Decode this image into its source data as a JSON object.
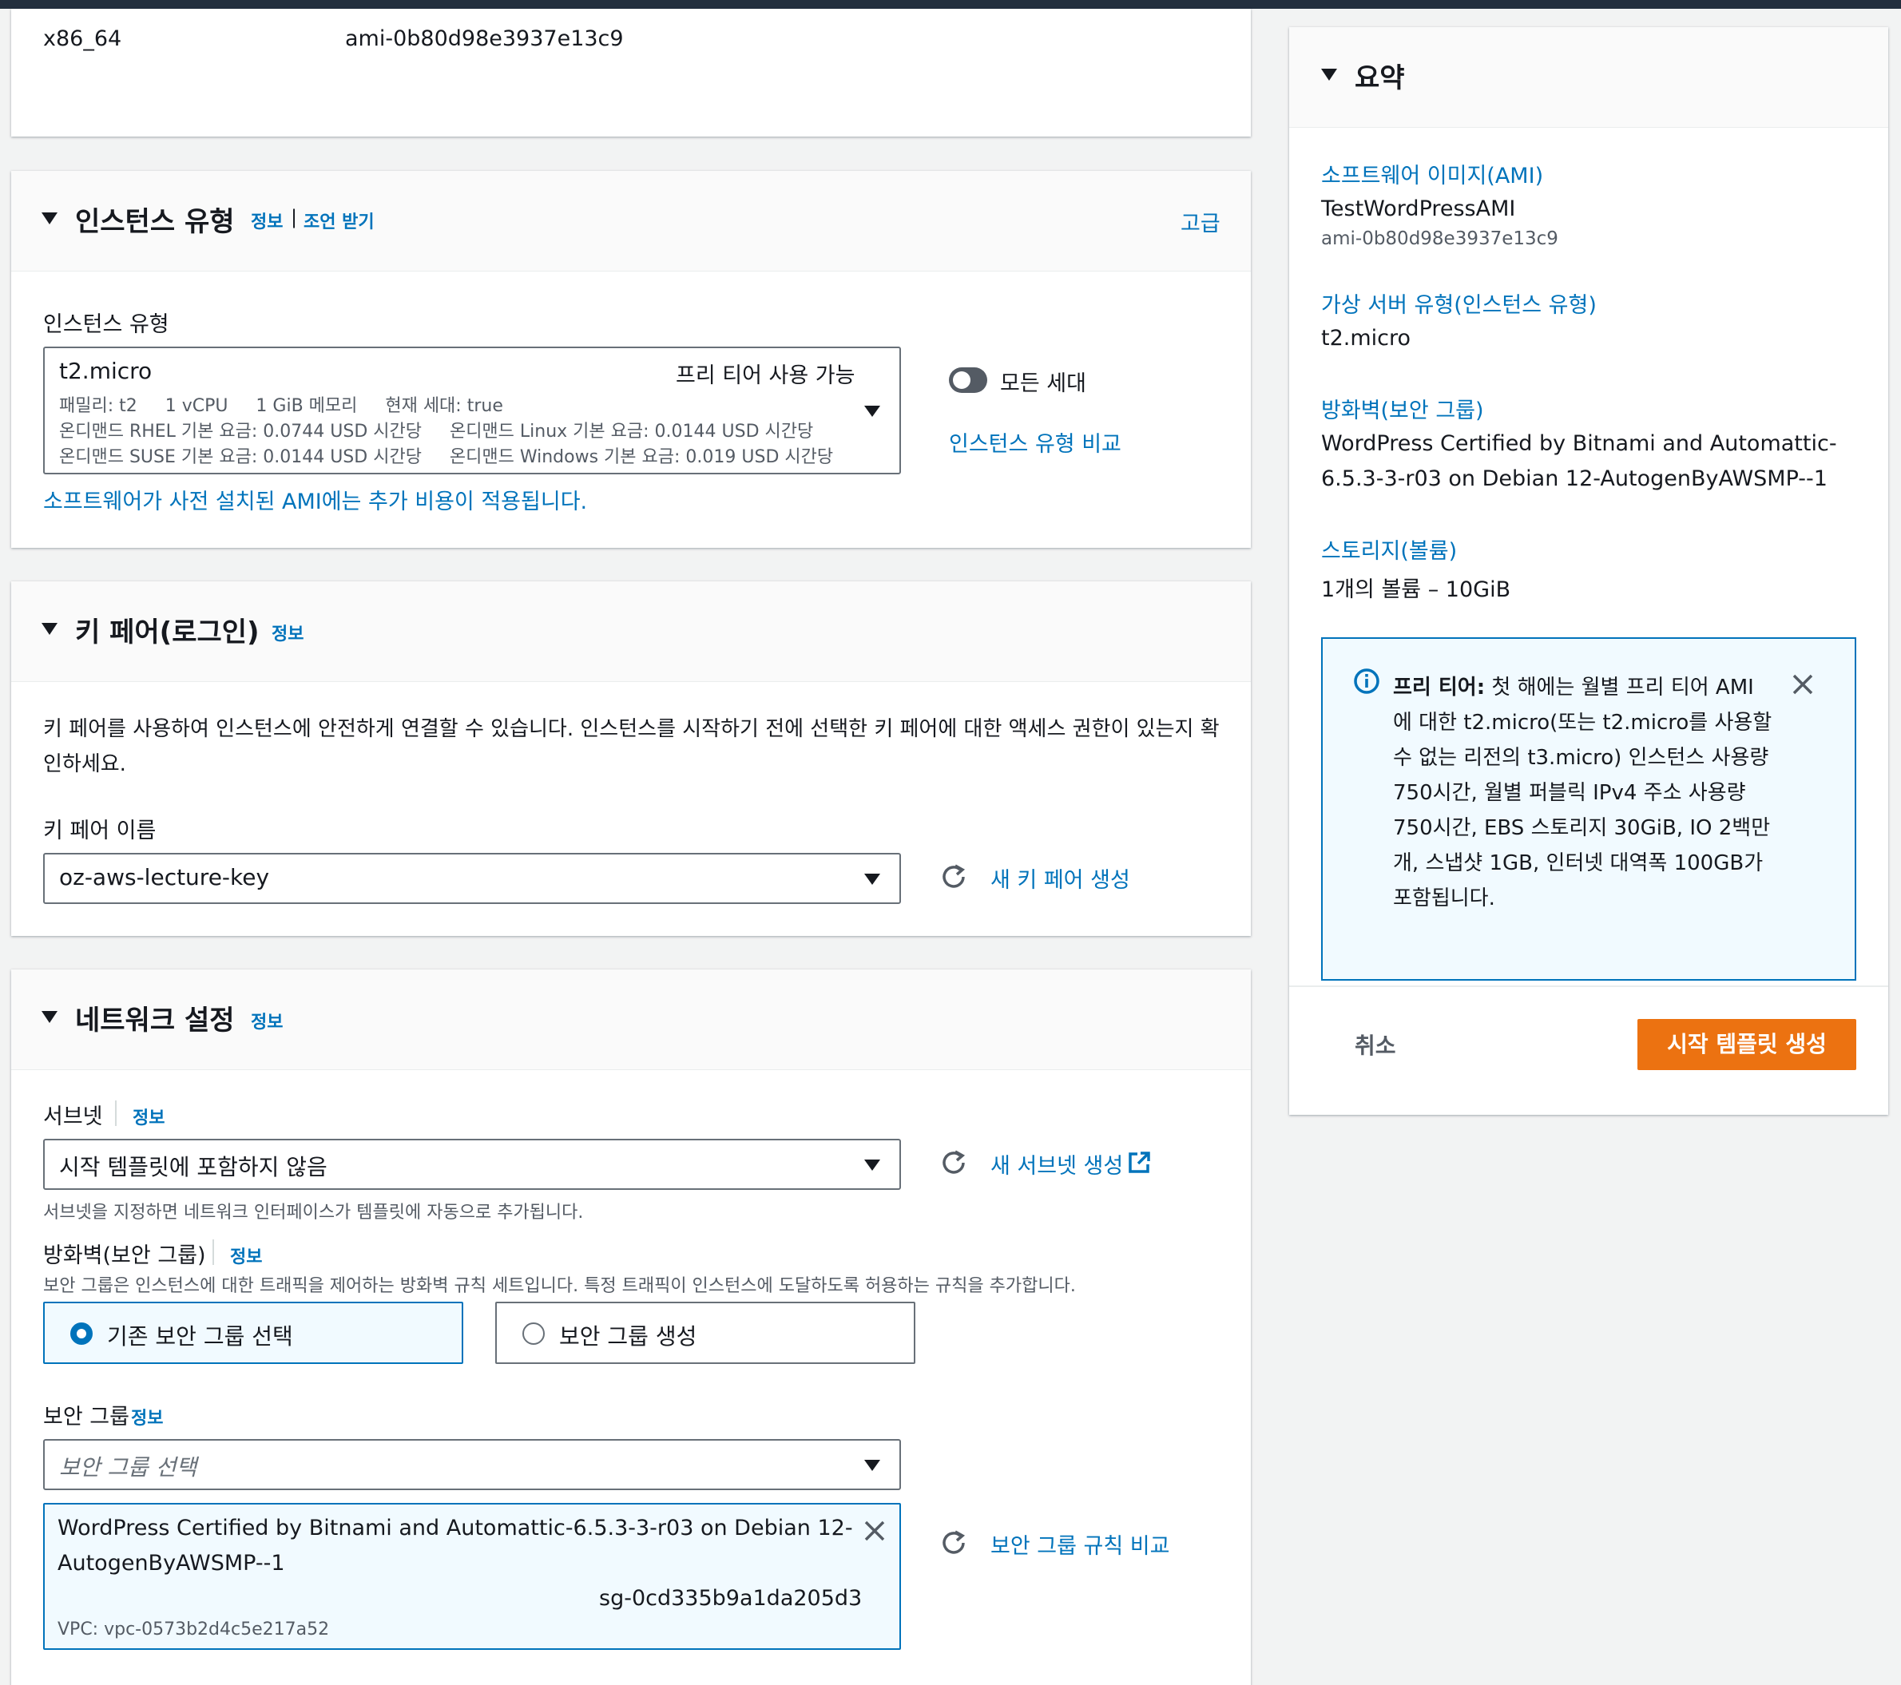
{
  "ami_row": {
    "arch": "x86_64",
    "ami_id": "ami-0b80d98e3937e13c9"
  },
  "instance_type": {
    "title": "인스턴스 유형",
    "info": "정보",
    "separator": "|",
    "advice": "조언 받기",
    "advanced": "고급",
    "field_label": "인스턴스 유형",
    "selected": {
      "name": "t2.micro",
      "free_tier": "프리 티어 사용 가능",
      "line1": "패밀리: t2     1 vCPU     1 GiB 메모리     현재 세대: true",
      "line2": "온디맨드 RHEL 기본 요금: 0.0744 USD 시간당     온디맨드 Linux 기본 요금: 0.0144 USD 시간당",
      "line3": "온디맨드 SUSE 기본 요금: 0.0144 USD 시간당     온디맨드 Windows 기본 요금: 0.019 USD 시간당"
    },
    "all_generations": "모든 세대",
    "compare": "인스턴스 유형 비교",
    "ami_cost_note": "소프트웨어가 사전 설치된 AMI에는 추가 비용이 적용됩니다."
  },
  "key_pair": {
    "title": "키 페어(로그인)",
    "info": "정보",
    "description_line1": "키 페어를 사용하여 인스턴스에 안전하게 연결할 수 있습니다. 인스턴스를 시작하기 전에 선택한 키 페어에 대한 액세스 권한이 있는지 확",
    "description_line2": "인하세요.",
    "field_label": "키 페어 이름",
    "value": "oz-aws-lecture-key",
    "create": "새 키 페어 생성"
  },
  "network": {
    "title": "네트워크 설정",
    "info": "정보",
    "subnet_label": "서브넷",
    "subnet_info": "정보",
    "subnet_value": "시작 템플릿에 포함하지 않음",
    "subnet_create": "새 서브넷 생성",
    "subnet_hint": "서브넷을 지정하면 네트워크 인터페이스가 템플릿에 자동으로 추가됩니다.",
    "firewall_label": "방화벽(보안 그룹)",
    "firewall_info": "정보",
    "firewall_desc": "보안 그룹은 인스턴스에 대한 트래픽을 제어하는 방화벽 규칙 세트입니다. 특정 트래픽이 인스턴스에 도달하도록 허용하는 규칙을 추가합니다.",
    "radio_existing": "기존 보안 그룹 선택",
    "radio_create": "보안 그룹 생성",
    "sg_label": "보안 그룹",
    "sg_info": "정보",
    "sg_placeholder": "보안 그룹 선택",
    "sg_token_line1": "WordPress Certified by Bitnami and Automattic-6.5.3-3-r03 on Debian 12-",
    "sg_token_line2": "AutogenByAWSMP--1",
    "sg_token_id": "sg-0cd335b9a1da205d3",
    "sg_token_vpc": "VPC: vpc-0573b2d4c5e217a52",
    "sg_compare": "보안 그룹 규칙 비교"
  },
  "summary": {
    "title": "요약",
    "ami_label": "소프트웨어 이미지(AMI)",
    "ami_name": "TestWordPressAMI",
    "ami_id": "ami-0b80d98e3937e13c9",
    "type_label": "가상 서버 유형(인스턴스 유형)",
    "type_value": "t2.micro",
    "firewall_label": "방화벽(보안 그룹)",
    "firewall_line1": "WordPress Certified by Bitnami and Automattic-",
    "firewall_line2": "6.5.3-3-r03 on Debian 12-AutogenByAWSMP--1",
    "storage_label": "스토리지(볼륨)",
    "storage_value": "1개의 볼륨 – 10GiB",
    "free_tier": {
      "bold": "프리 티어:",
      "line1": " 첫 해에는 월별 프리 티어 AMI",
      "line2": "에 대한 t2.micro(또는 t2.micro를 사용할",
      "line3": "수 없는 리전의 t3.micro) 인스턴스 사용량",
      "line4": "750시간, 월별 퍼블릭 IPv4 주소 사용량",
      "line5": "750시간, EBS 스토리지 30GiB, IO 2백만",
      "line6": "개, 스냅샷 1GB, 인터넷 대역폭 100GB가",
      "line7": "포함됩니다."
    },
    "cancel": "취소",
    "create": "시작 템플릿 생성"
  },
  "colors": {
    "link": "#0073bb",
    "primary": "#ec7211",
    "topbar": "#232f3e"
  }
}
